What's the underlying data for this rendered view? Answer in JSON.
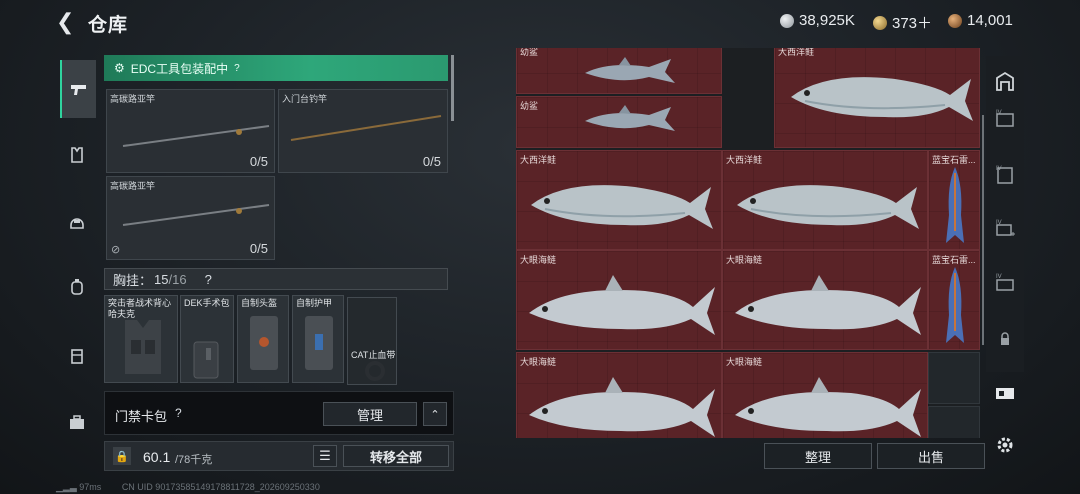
{
  "header": {
    "title": "仓库",
    "currencies": [
      {
        "name": "silver",
        "value": "38,925K",
        "color": "#bfc4c8"
      },
      {
        "name": "gold",
        "value": "373＋",
        "color": "#c9a45a"
      },
      {
        "name": "bronze",
        "value": "14,001",
        "color": "#b07a46"
      }
    ]
  },
  "left_nav": [
    "pistol-icon",
    "vest-icon",
    "helmet-icon",
    "backpack-icon",
    "bag-icon",
    "toolbox-icon"
  ],
  "edc": {
    "label": "EDC工具包装配中",
    "hint": "?"
  },
  "rods": [
    {
      "label": "高碳路亚竿",
      "count": "0/5"
    },
    {
      "label": "入门台钓竿",
      "count": "0/5"
    },
    {
      "label": "高碳路亚竿",
      "count": "0/5"
    }
  ],
  "chest": {
    "label": "胸挂：",
    "used": "15",
    "total": "/16",
    "hint": "?"
  },
  "chest_items": [
    {
      "label": "突击者战术背心\n哈夫克"
    },
    {
      "label": "DEK手术包"
    },
    {
      "label": "自制头盔"
    },
    {
      "label": "自制护甲"
    },
    {
      "label": "CAT止血带"
    }
  ],
  "card_pack": {
    "label": "门禁卡包",
    "hint": "?",
    "manage_label": "管理"
  },
  "weight": {
    "value": "60.1",
    "max": "/78千克",
    "transfer_label": "转移全部"
  },
  "grid_labels": {
    "top_left": "幼鲨",
    "top_right": "大西洋鲑",
    "shark2": "幼鲨",
    "salmon_a": "大西洋鲑",
    "salmon_b": "大西洋鲑",
    "blue1": "蓝宝石雷...",
    "tarpon_a": "大眼海鲢",
    "tarpon_b": "大眼海鲢",
    "blue2": "蓝宝石雷...",
    "tarpon_c": "大眼海鲢",
    "tarpon_d": "大眼海鲢"
  },
  "bottom_buttons": {
    "sort": "整理",
    "sell": "出售"
  },
  "footer": {
    "ping": "97ms",
    "uid": "CN UID 90173585149178811728_202609250330"
  }
}
